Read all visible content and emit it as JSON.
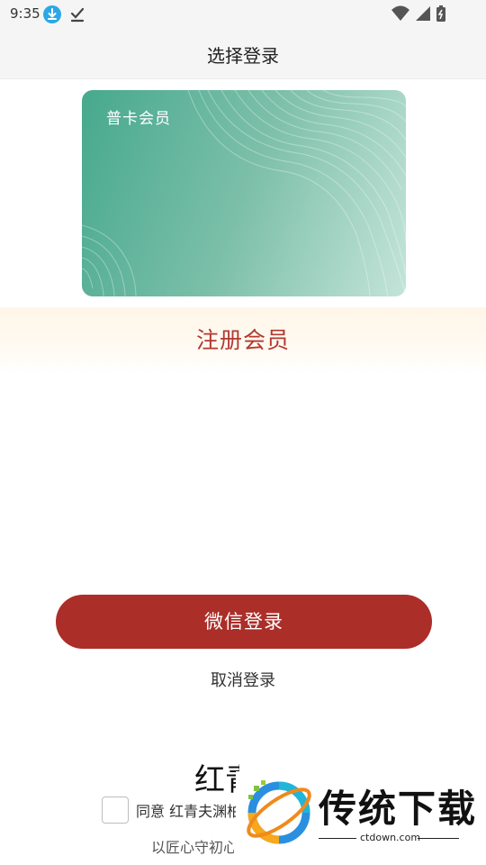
{
  "status_bar": {
    "time": "9:35",
    "icons": [
      "download-icon",
      "check-icon",
      "wifi-icon",
      "signal-icon",
      "battery-icon"
    ]
  },
  "header": {
    "title": "选择登录"
  },
  "card": {
    "label": "普卡会员",
    "gradient": [
      "#46a98d",
      "#c4e4da"
    ]
  },
  "register": {
    "label": "注册会员",
    "color": "#b23a30"
  },
  "wechat_login": {
    "label": "微信登录",
    "color": "#ab2e28"
  },
  "cancel_login": {
    "label": "取消登录"
  },
  "footer": {
    "brand": "红青",
    "agreement_text": "同意 红青夫渊柏",
    "agreed": false,
    "slogan": "以匠心守初心"
  },
  "watermark": {
    "title": "传统下载",
    "subtitle": "ctdown.com"
  }
}
